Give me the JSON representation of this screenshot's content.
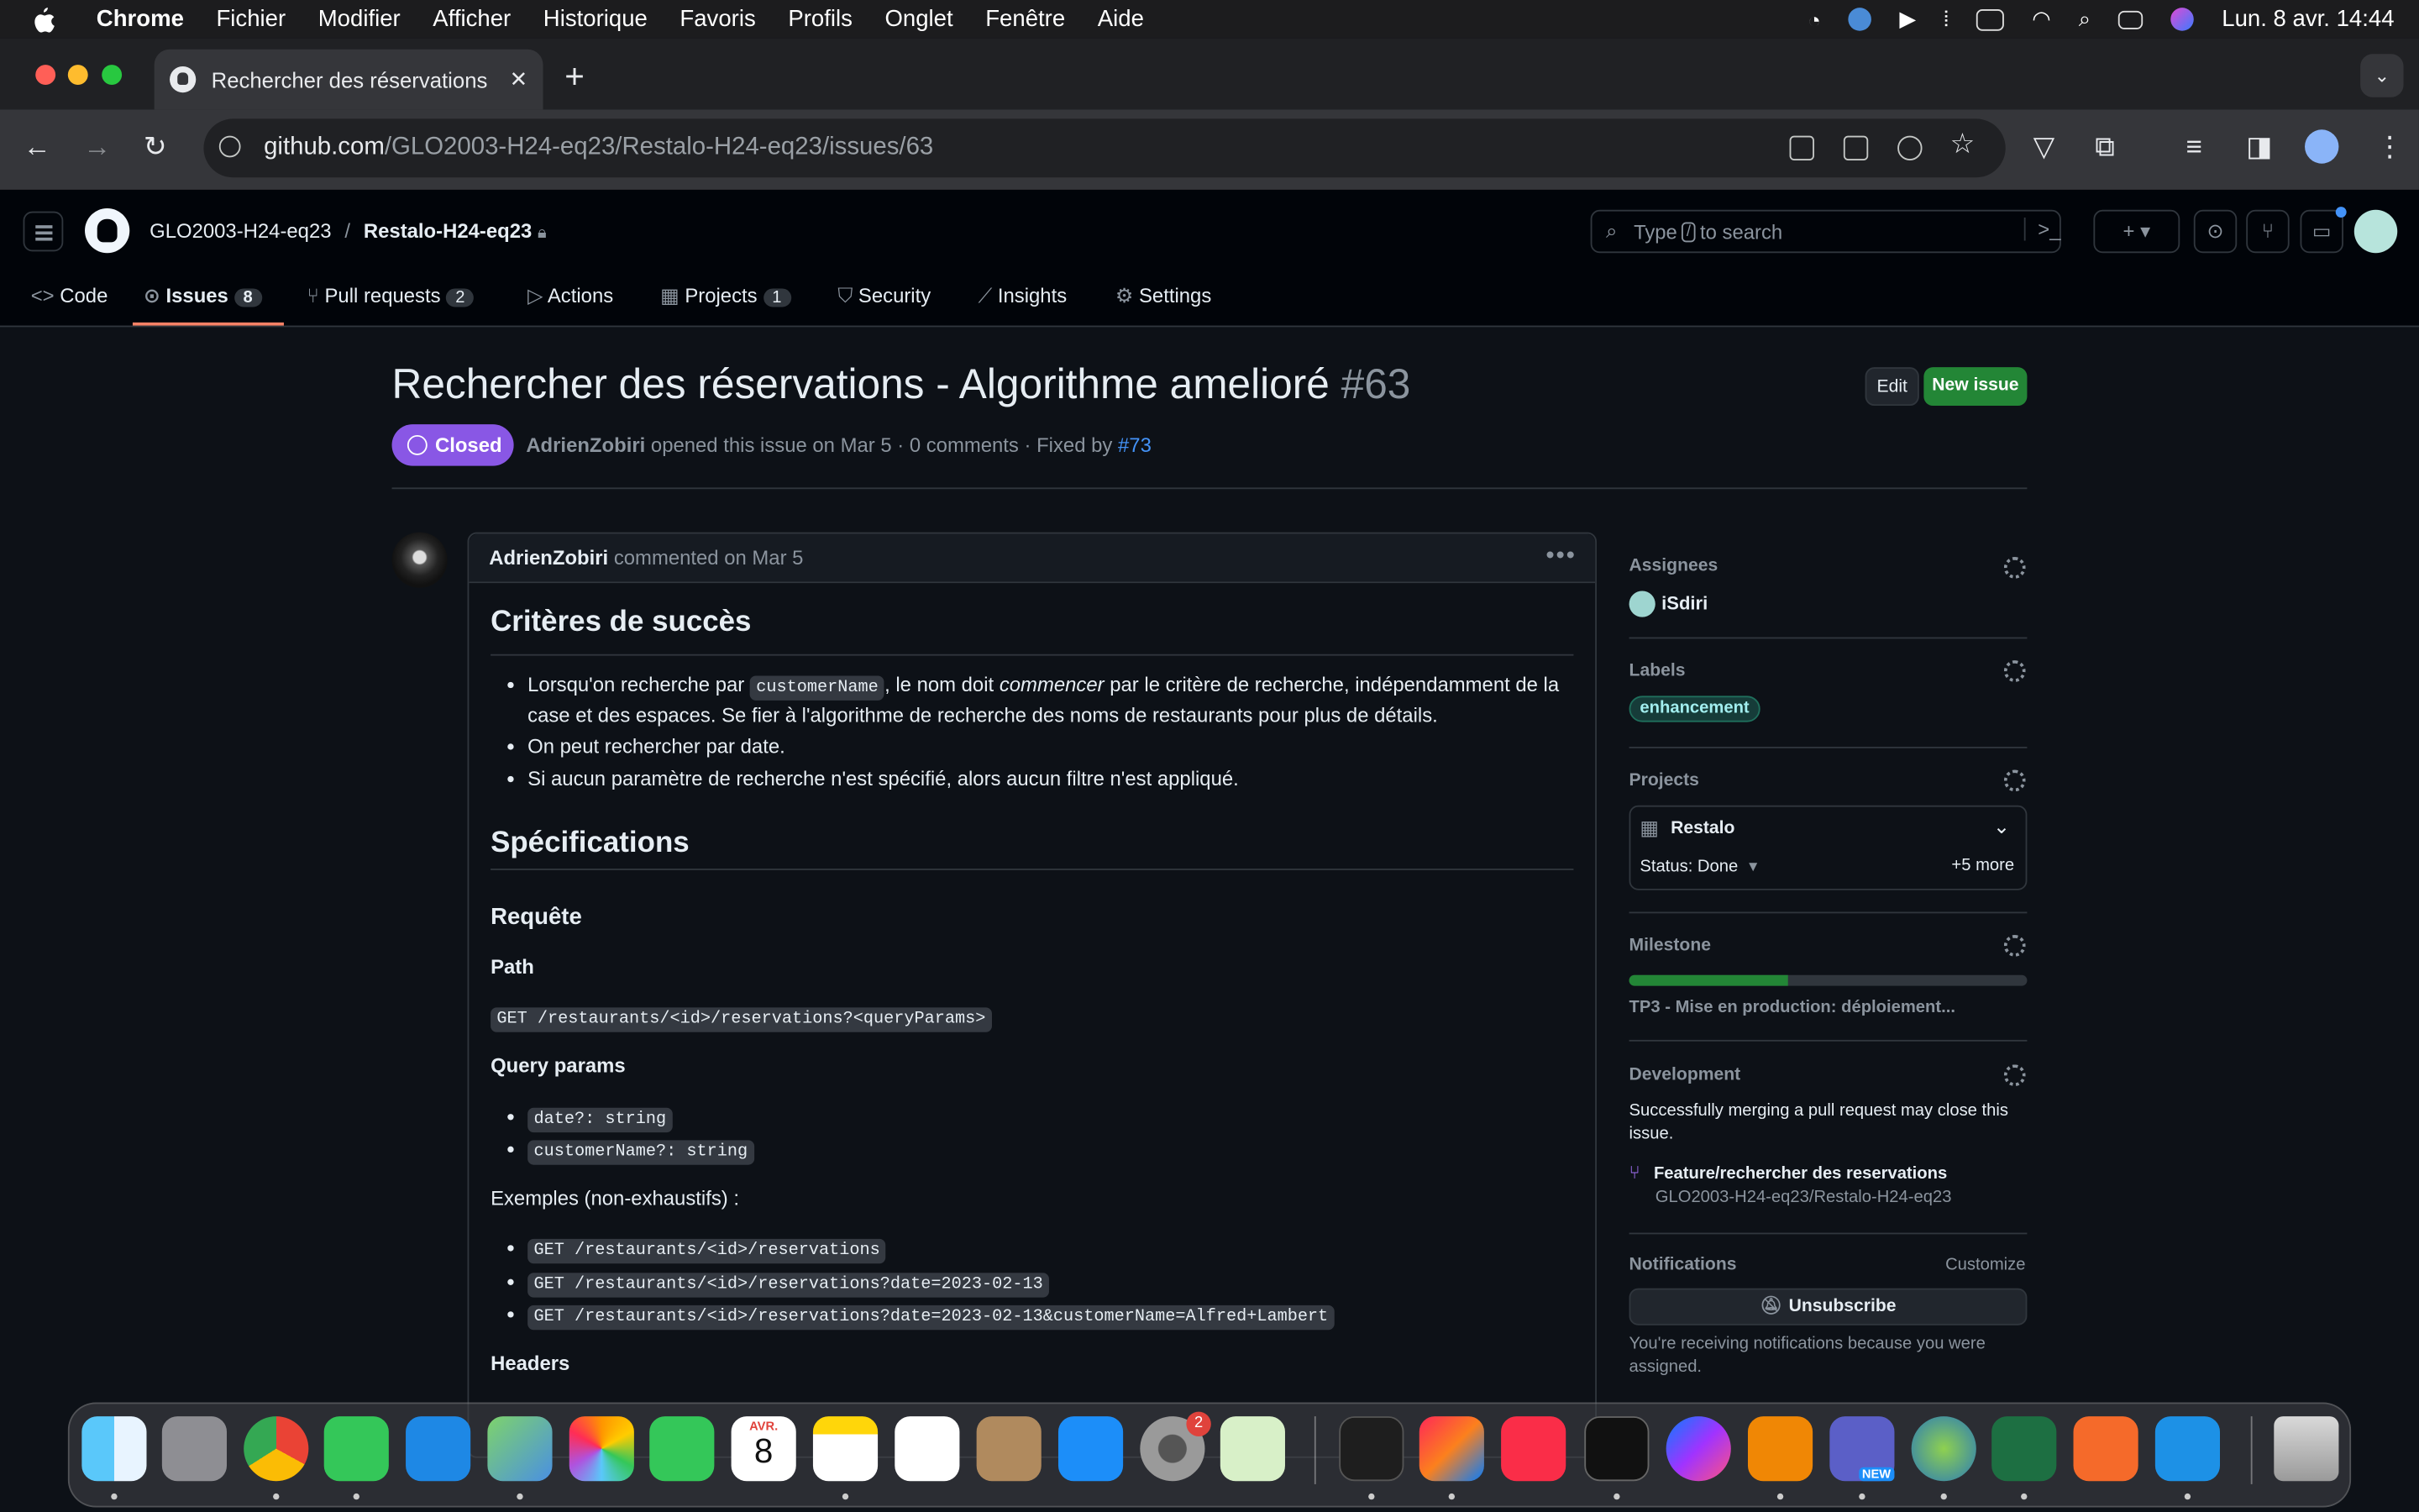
{
  "menubar": {
    "app": "Chrome",
    "items": [
      "Fichier",
      "Modifier",
      "Afficher",
      "Historique",
      "Favoris",
      "Profils",
      "Onglet",
      "Fenêtre",
      "Aide"
    ],
    "clock": "Lun. 8 avr. 14:44"
  },
  "browser": {
    "tab_title": "Rechercher des réservations",
    "url_host": "github.com",
    "url_path": "/GLO2003-H24-eq23/Restalo-H24-eq23/issues/63"
  },
  "repo": {
    "owner": "GLO2003-H24-eq23",
    "separator": "/",
    "name": "Restalo-H24-eq23"
  },
  "search": {
    "pre": "Type",
    "key": "/",
    "post": "to search"
  },
  "nav": [
    {
      "label": "Code"
    },
    {
      "label": "Issues",
      "count": "8"
    },
    {
      "label": "Pull requests",
      "count": "2"
    },
    {
      "label": "Actions"
    },
    {
      "label": "Projects",
      "count": "1"
    },
    {
      "label": "Security"
    },
    {
      "label": "Insights"
    },
    {
      "label": "Settings"
    }
  ],
  "issue": {
    "title": "Rechercher des réservations - Algorithme amelioré",
    "number": "#63",
    "edit": "Edit",
    "new_issue": "New issue",
    "state": "Closed",
    "author": "AdrienZobiri",
    "meta": "opened this issue on Mar 5 · 0 comments · Fixed by",
    "fixed_by": "#73"
  },
  "comment": {
    "author": "AdrienZobiri",
    "when": "commented on Mar 5",
    "h_criteria": "Critères de succès",
    "b1_a": "Lorsqu'on recherche par",
    "b1_code": "customerName",
    "b1_b": ", le nom doit",
    "b1_em": "commencer",
    "b1_c": "par le critère de recherche, indépendamment de la",
    "b1_d": "case et des espaces. Se fier à l'algorithme de recherche des noms de restaurants pour plus de détails.",
    "b2": "On peut rechercher par date.",
    "b3": "Si aucun paramètre de recherche n'est spécifié, alors aucun filtre n'est appliqué.",
    "h_specs": "Spécifications",
    "h_request": "Requête",
    "h_path": "Path",
    "path_code": "GET /restaurants/<id>/reservations?<queryParams>",
    "h_query": "Query params",
    "q1": "date?: string",
    "q2": "customerName?: string",
    "examples": "Exemples (non-exhaustifs) :",
    "e1": "GET /restaurants/<id>/reservations",
    "e2": "GET /restaurants/<id>/reservations?date=2023-02-13",
    "e3": "GET /restaurants/<id>/reservations?date=2023-02-13&customerName=Alfred+Lambert",
    "h_headers": "Headers"
  },
  "sidebar": {
    "assignees": "Assignees",
    "assignee": "iSdiri",
    "labels": "Labels",
    "label": "enhancement",
    "projects": "Projects",
    "project": "Restalo",
    "status": "Status: Done",
    "more": "+5 more",
    "milestone": "Milestone",
    "milestone_progress": 0.4,
    "milestone_name": "TP3 - Mise en production: déploiement...",
    "development": "Development",
    "dev_text1": "Successfully merging a pull request may close this",
    "dev_text2": "issue.",
    "branch": "Feature/rechercher des reservations",
    "branch_repo": "GLO2003-H24-eq23/Restalo-H24-eq23",
    "notifications": "Notifications",
    "customize": "Customize",
    "unsubscribe": "Unsubscribe",
    "notif_text1": "You're receiving notifications because you were",
    "notif_text2": "assigned."
  },
  "dock": {
    "calendar_month": "AVR.",
    "calendar_day": "8",
    "badge": "2",
    "teams_tag": "NEW"
  }
}
